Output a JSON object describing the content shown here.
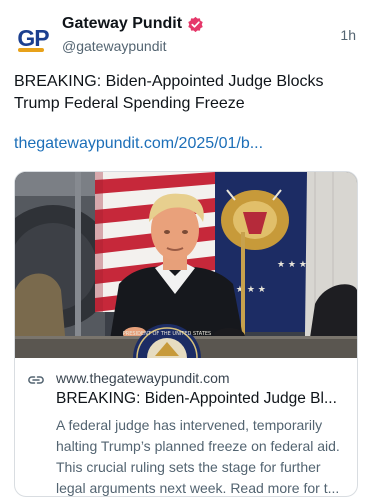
{
  "post": {
    "author_name": "Gateway Pundit",
    "author_handle": "@gatewaypundit",
    "avatar_text": "GP",
    "timestamp": "1h",
    "text": "BREAKING: Biden-Appointed Judge Blocks Trump Federal Spending Freeze",
    "link_text": "thegatewaypundit.com/2025/01/b..."
  },
  "card": {
    "domain": "www.thegatewaypundit.com",
    "title": "BREAKING: Biden-Appointed Judge Bl...",
    "description_lines": [
      "A federal judge has intervened, temporarily",
      "halting Trump’s planned freeze on federal aid.",
      "This crucial ruling sets the stage for further",
      "legal arguments next week. Read more for t..."
    ],
    "image_seal_text": "PRESIDENT OF THE UNITED STATES"
  },
  "colors": {
    "verified_badge": "#e5386a",
    "link": "#1d6fb8",
    "secondary_text": "#536471"
  },
  "icons": {
    "verified": "verified-badge-icon",
    "link": "link-icon"
  }
}
